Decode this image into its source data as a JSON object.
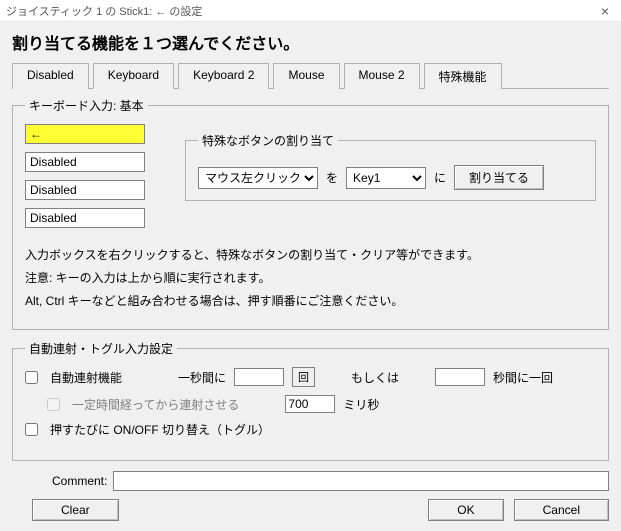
{
  "window": {
    "title": "ジョイスティック 1 の Stick1: ← の設定"
  },
  "heading": "割り当てる機能を１つ選んでください。",
  "tabs": [
    "Disabled",
    "Keyboard",
    "Keyboard 2",
    "Mouse",
    "Mouse 2",
    "特殊機能"
  ],
  "kb_group": {
    "legend": "キーボード入力: 基本",
    "inputs": [
      "←",
      "Disabled",
      "Disabled",
      "Disabled"
    ],
    "special": {
      "legend": "特殊なボタンの割り当て",
      "combo1": "マウス左クリック",
      "wo": "を",
      "combo2": "Key1",
      "ni": "に",
      "assign_btn": "割り当てる"
    },
    "note1": "入力ボックスを右クリックすると、特殊なボタンの割り当て・クリア等ができます。",
    "note2": "注意: キーの入力は上から順に実行されます。",
    "note3": "Alt, Ctrl キーなどと組み合わせる場合は、押す順番にご注意ください。"
  },
  "auto": {
    "legend": "自動連射・トグル入力設定",
    "cb1": "自動連射機能",
    "per_sec_label": "一秒間に",
    "per_sec_value": "",
    "kai": "回",
    "or": "もしくは",
    "sec_value": "",
    "sec_label": "秒間に一回",
    "cb2": "一定時間経ってから連射させる",
    "delay_value": "700",
    "ms": "ミリ秒",
    "cb3": "押すたびに ON/OFF 切り替え（トグル）"
  },
  "comment_label": "Comment:",
  "buttons": {
    "clear": "Clear",
    "ok": "OK",
    "cancel": "Cancel"
  }
}
